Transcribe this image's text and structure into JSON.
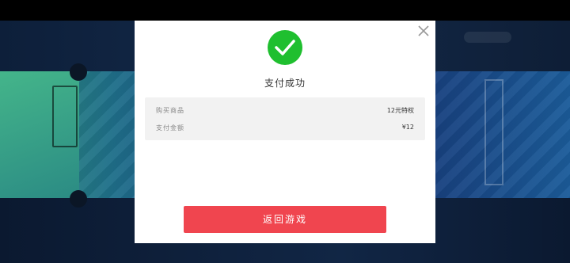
{
  "dialog": {
    "title": "支付成功",
    "close_icon": "close-icon",
    "status_icon": "check-circle-icon",
    "accent_color": "#1fbf2f",
    "details": [
      {
        "label": "购买商品",
        "value": "12元特权"
      },
      {
        "label": "支付金额",
        "value": "¥12"
      }
    ],
    "return_button": {
      "label": "返回游戏",
      "color": "#f0454f"
    }
  }
}
